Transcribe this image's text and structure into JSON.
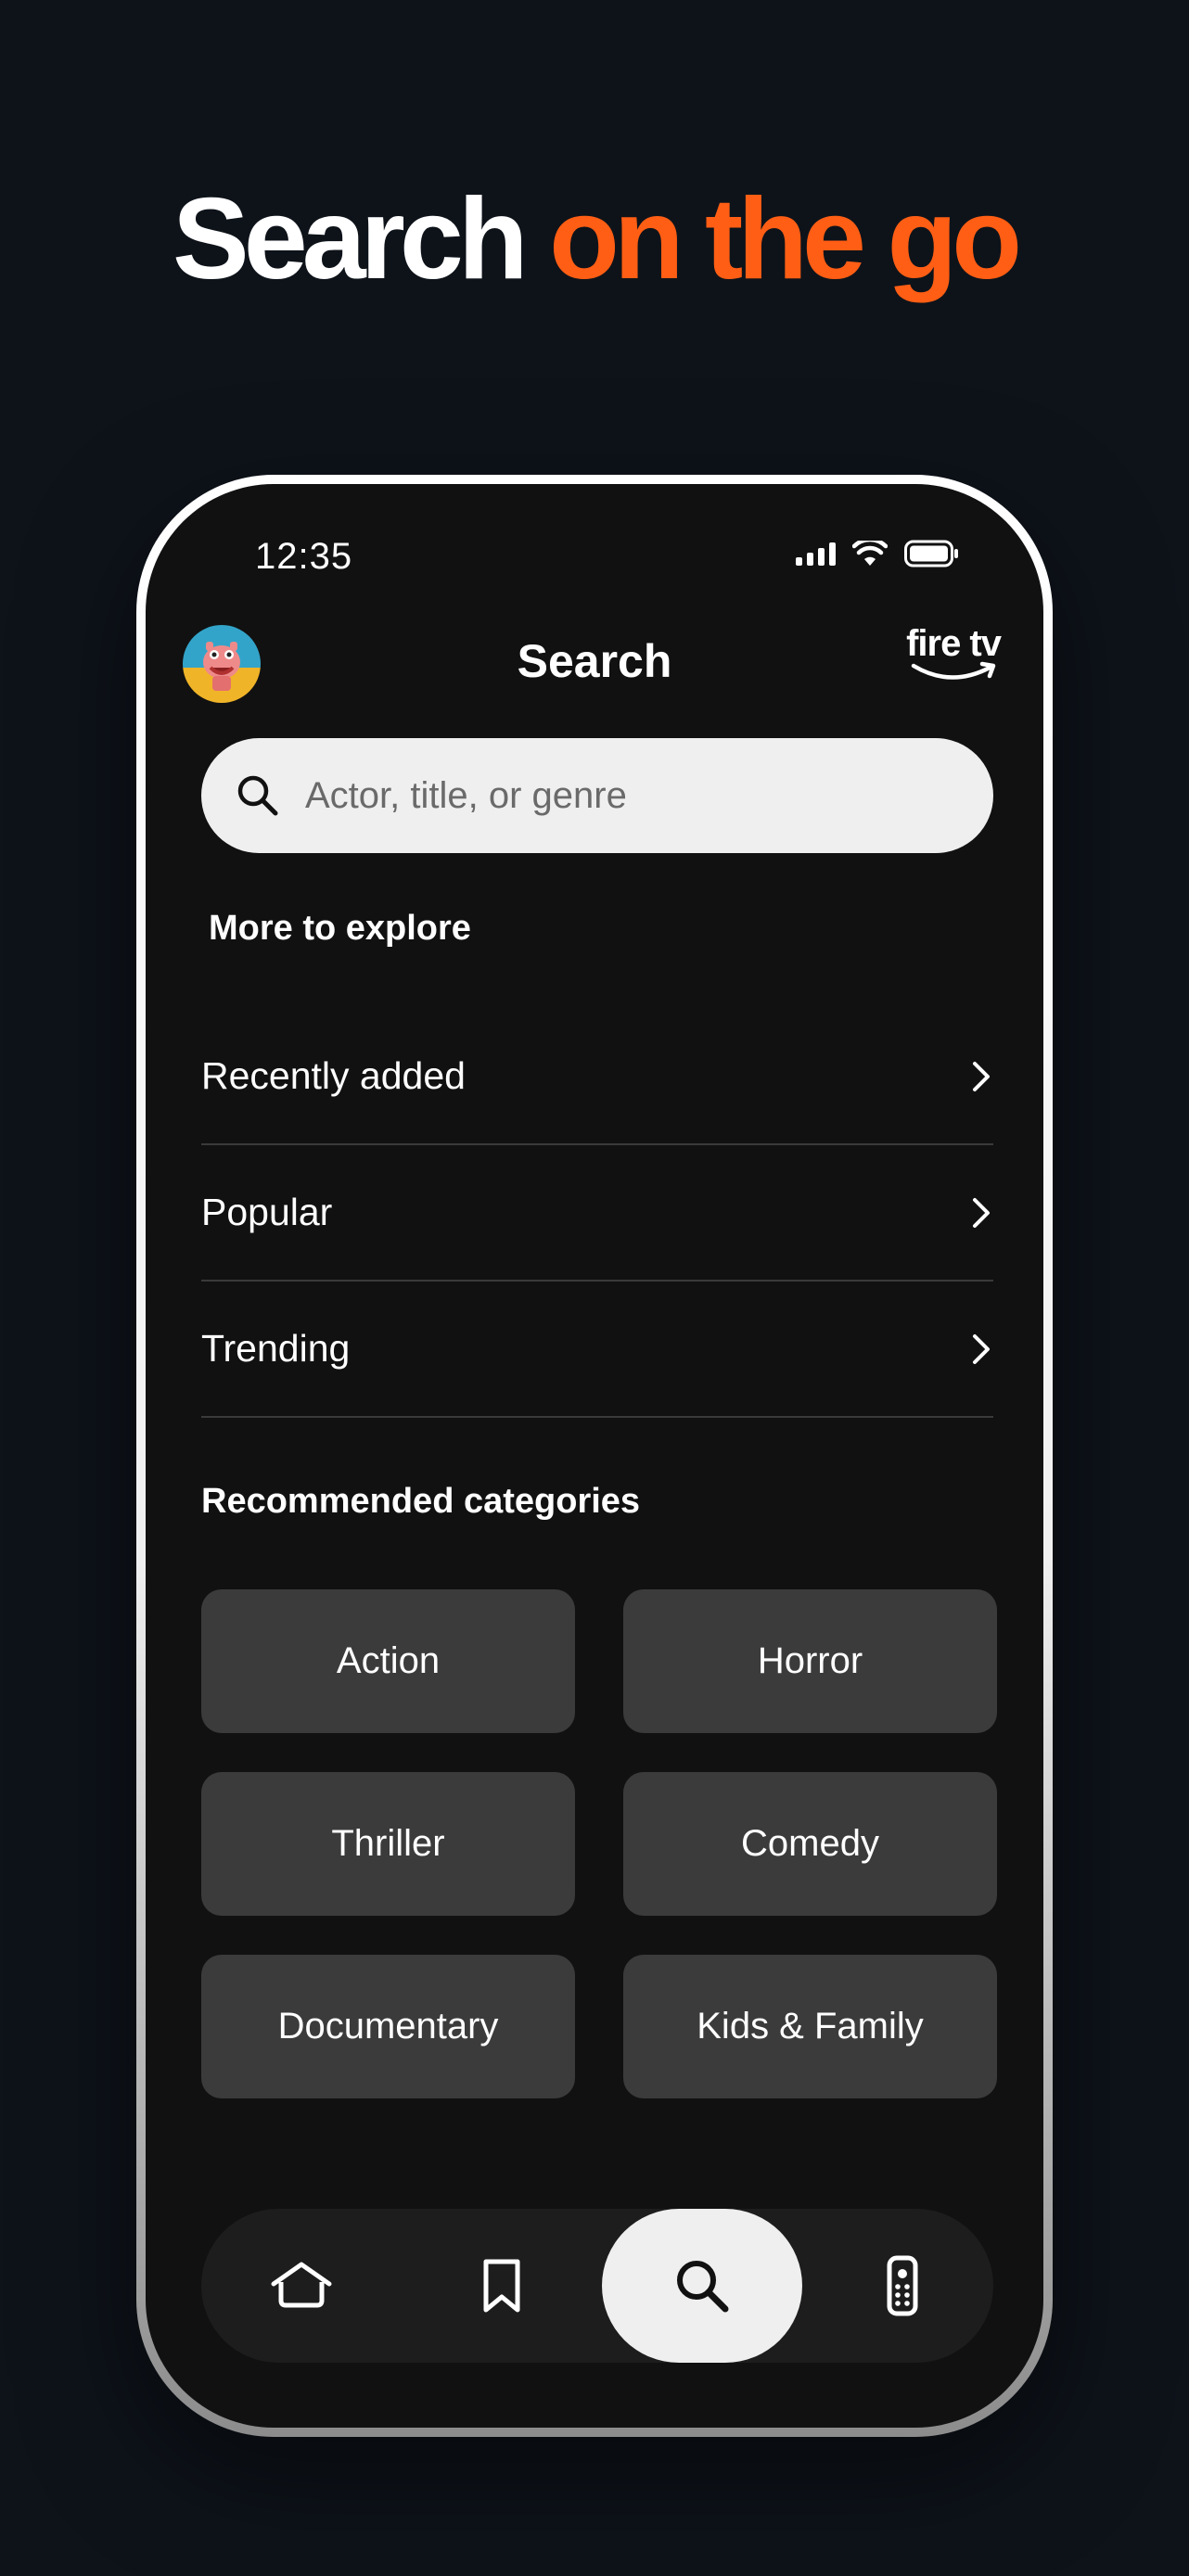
{
  "headline": {
    "part1": "Search",
    "part2": "on the go"
  },
  "colors": {
    "accent": "#ff5e14",
    "background": "#0e131a",
    "screen": "#111111",
    "tile": "#3b3b3b"
  },
  "status_bar": {
    "time": "12:35",
    "icons": [
      "signal-icon",
      "wifi-icon",
      "battery-icon"
    ]
  },
  "top_bar": {
    "title": "Search",
    "brand": "fire tv",
    "avatar": "avatar"
  },
  "search": {
    "placeholder": "Actor, title, or genre",
    "value": ""
  },
  "explore": {
    "title": "More to explore",
    "items": [
      {
        "label": "Recently added"
      },
      {
        "label": "Popular"
      },
      {
        "label": "Trending"
      }
    ]
  },
  "categories": {
    "title": "Recommended categories",
    "items": [
      {
        "label": "Action"
      },
      {
        "label": "Horror"
      },
      {
        "label": "Thriller"
      },
      {
        "label": "Comedy"
      },
      {
        "label": "Documentary"
      },
      {
        "label": "Kids & Family"
      }
    ]
  },
  "bottom_nav": {
    "items": [
      {
        "icon": "home-icon"
      },
      {
        "icon": "bookmark-icon"
      },
      {
        "icon": "search-icon",
        "active": true
      },
      {
        "icon": "remote-icon"
      }
    ]
  }
}
